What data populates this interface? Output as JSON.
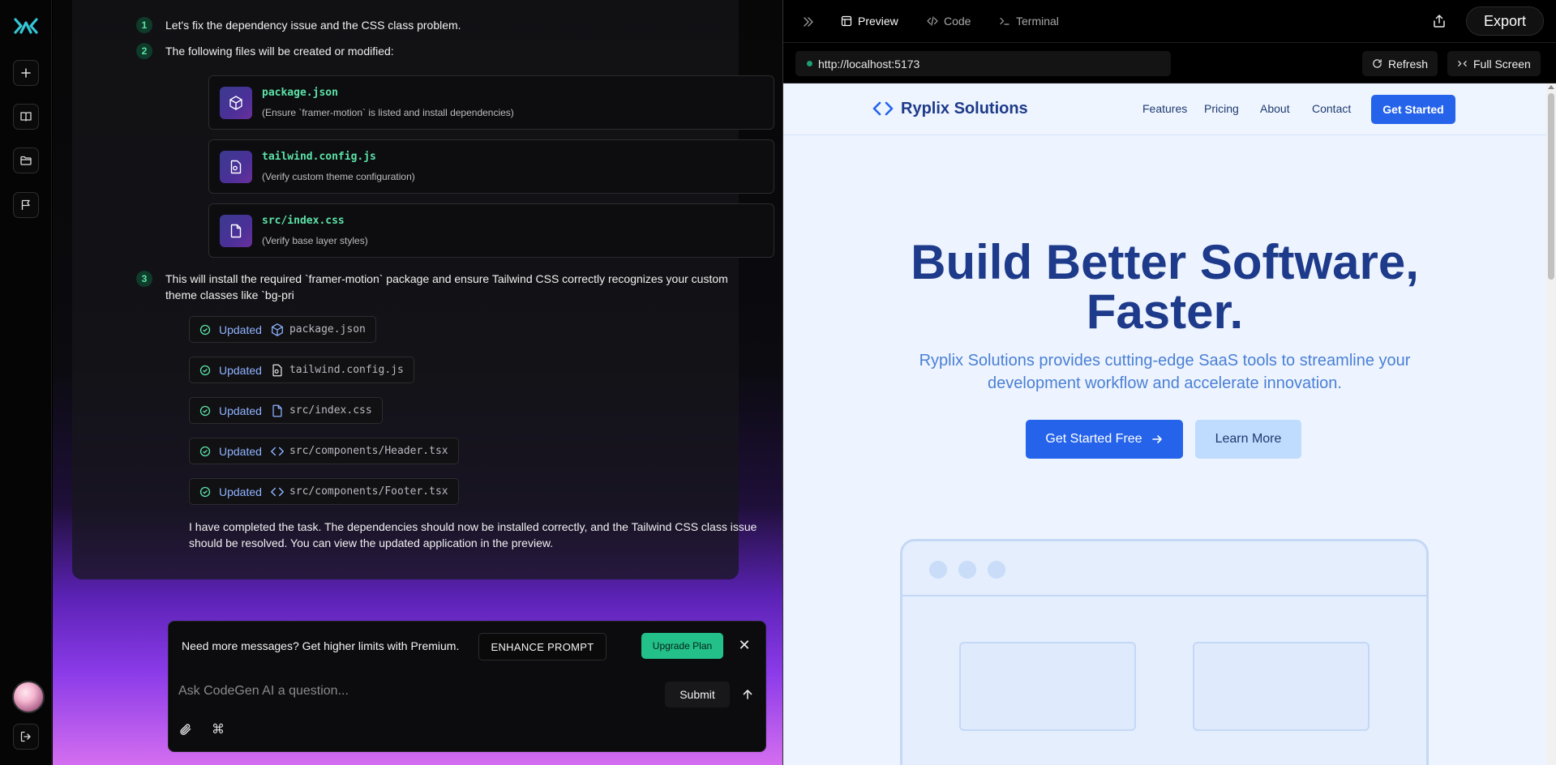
{
  "chat": {
    "steps": [
      {
        "num": "1",
        "text": "Let's fix the dependency issue and the CSS class problem."
      },
      {
        "num": "2",
        "text": "The following files will be created or modified:"
      },
      {
        "num": "3",
        "text": "This will install the required `framer-motion` package and ensure Tailwind CSS correctly recognizes your custom theme classes like `bg-pri"
      }
    ],
    "files": [
      {
        "name": "package.json",
        "desc": "(Ensure `framer-motion` is listed and install dependencies)",
        "icon": "package-icon"
      },
      {
        "name": "tailwind.config.js",
        "desc": "(Verify custom theme configuration)",
        "icon": "config-file-icon"
      },
      {
        "name": "src/index.css",
        "desc": "(Verify base layer styles)",
        "icon": "file-icon"
      }
    ],
    "updates": [
      {
        "label": "Updated",
        "path": "package.json",
        "icon": "package-icon"
      },
      {
        "label": "Updated",
        "path": "tailwind.config.js",
        "icon": "config-file-icon"
      },
      {
        "label": "Updated",
        "path": "src/index.css",
        "icon": "file-icon"
      },
      {
        "label": "Updated",
        "path": "src/components/Header.tsx",
        "icon": "code-icon"
      },
      {
        "label": "Updated",
        "path": "src/components/Footer.tsx",
        "icon": "code-icon"
      }
    ],
    "final_message": "I have completed the task. The dependencies should now be installed correctly, and the Tailwind CSS class issue should be resolved. You can view the updated application in the preview."
  },
  "prompt": {
    "limit_text": "Need more messages? Get higher limits with Premium.",
    "enhance_label": "ENHANCE PROMPT",
    "upgrade_label": "Upgrade Plan",
    "close_label": "✕",
    "placeholder": "Ask CodeGen AI a question...",
    "submit_label": "Submit",
    "cmd_label": "⌘"
  },
  "topbar": {
    "tabs": [
      {
        "label": "Preview",
        "active": true
      },
      {
        "label": "Code",
        "active": false
      },
      {
        "label": "Terminal",
        "active": false
      }
    ],
    "export_label": "Export"
  },
  "urlbar": {
    "url": "http://localhost:5173",
    "refresh_label": "Refresh",
    "fullscreen_label": "Full Screen"
  },
  "site": {
    "brand": "Ryplix Solutions",
    "nav": [
      "Features",
      "Pricing",
      "About",
      "Contact"
    ],
    "nav_cta": "Get Started",
    "hero_title_line1": "Build Better Software,",
    "hero_title_line2": "Faster.",
    "hero_subtitle": "Ryplix Solutions provides cutting-edge SaaS tools to streamline your development workflow and accelerate innovation.",
    "cta_primary": "Get Started Free",
    "cta_secondary": "Learn More"
  },
  "colors": {
    "accent_green": "#5ce3a8",
    "upgrade_green": "#23c08a",
    "site_blue": "#2563eb",
    "site_navy": "#1e3a8a"
  }
}
